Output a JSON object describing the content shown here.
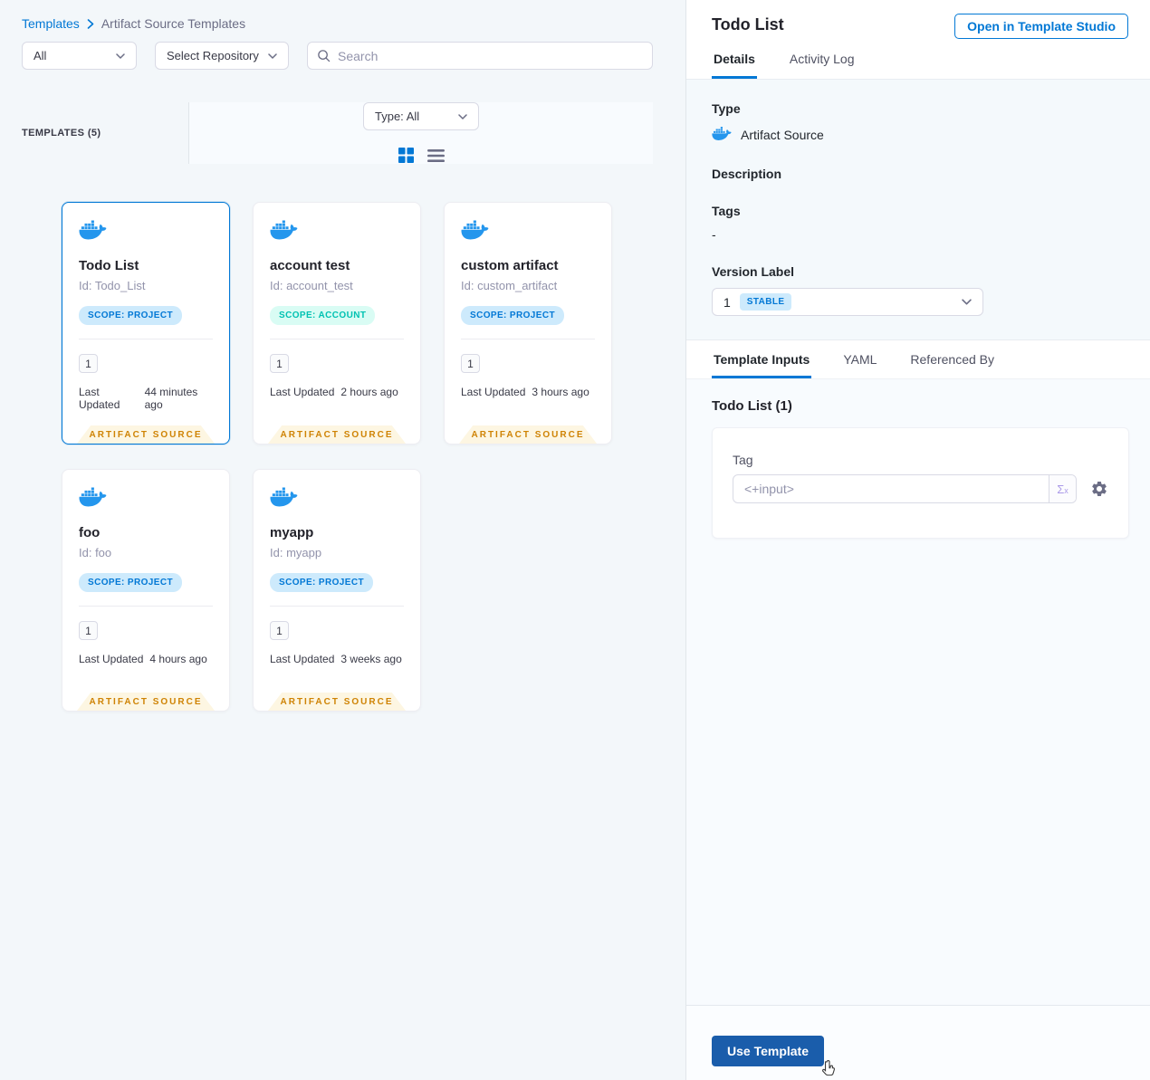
{
  "labels": {
    "last_updated": "Last Updated",
    "artifact_source_banner": "ARTIFACT SOURCE"
  },
  "breadcrumb": {
    "root": "Templates",
    "current": "Artifact Source Templates"
  },
  "filters": {
    "scope": "All",
    "repository": "Select Repository",
    "search_placeholder": "Search"
  },
  "list_header": {
    "count": "TEMPLATES (5)",
    "type_filter": "Type: All"
  },
  "cards": [
    {
      "title": "Todo List",
      "id": "Id: Todo_List",
      "scope": "SCOPE: PROJECT",
      "scope_type": "project",
      "version": "1",
      "updated": "44 minutes ago",
      "selected": true
    },
    {
      "title": "account test",
      "id": "Id: account_test",
      "scope": "SCOPE: ACCOUNT",
      "scope_type": "account",
      "version": "1",
      "updated": "2 hours ago",
      "selected": false
    },
    {
      "title": "custom artifact",
      "id": "Id: custom_artifact",
      "scope": "SCOPE: PROJECT",
      "scope_type": "project",
      "version": "1",
      "updated": "3 hours ago",
      "selected": false
    },
    {
      "title": "foo",
      "id": "Id: foo",
      "scope": "SCOPE: PROJECT",
      "scope_type": "project",
      "version": "1",
      "updated": "4 hours ago",
      "selected": false
    },
    {
      "title": "myapp",
      "id": "Id: myapp",
      "scope": "SCOPE: PROJECT",
      "scope_type": "project",
      "version": "1",
      "updated": "3 weeks ago",
      "selected": false
    }
  ],
  "panel": {
    "title": "Todo List",
    "open_in_studio": "Open in Template Studio",
    "tabs": {
      "details": "Details",
      "activity_log": "Activity Log"
    },
    "details": {
      "type_label": "Type",
      "type_value": "Artifact Source",
      "description_label": "Description",
      "tags_label": "Tags",
      "tags_value": "-",
      "version_label": "Version Label",
      "version_value": "1",
      "version_badge": "STABLE"
    },
    "sub_tabs": {
      "inputs": "Template Inputs",
      "yaml": "YAML",
      "referenced_by": "Referenced By"
    },
    "inputs": {
      "heading": "Todo List (1)",
      "tag_label": "Tag",
      "tag_value": "<+input>",
      "expression_sigma": "Σ",
      "expression_sub": "x"
    },
    "footer": {
      "use_template": "Use Template"
    }
  },
  "colors": {
    "accent": "#0278d5",
    "docker_blue": "#2496ed",
    "banner_bg": "#fdf6e2",
    "banner_text": "#cf8304",
    "badge_project_bg": "#cdeafc",
    "badge_account_text": "#00c2b2",
    "primary_button": "#1a5dab",
    "left_background": "#f3f7fa",
    "details_background": "#f4f9fc"
  }
}
